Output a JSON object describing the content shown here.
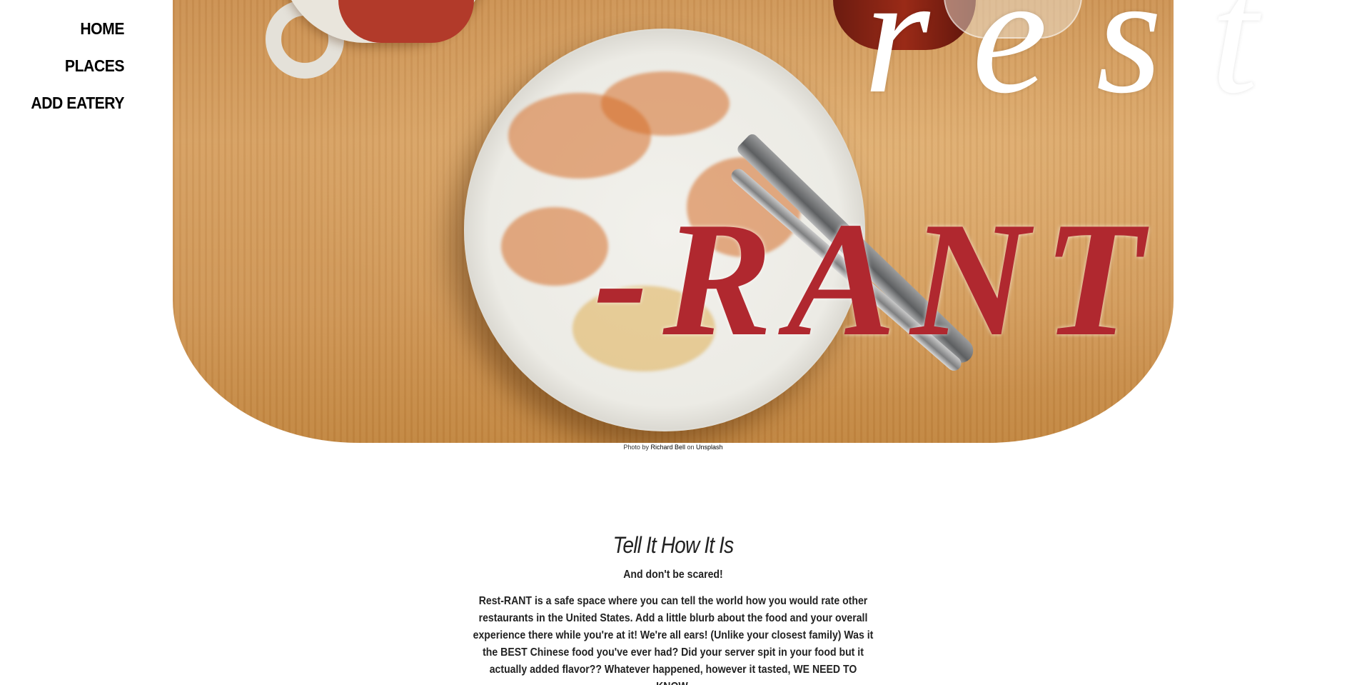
{
  "nav": {
    "items": [
      {
        "label": "HOME"
      },
      {
        "label": "PLACES"
      },
      {
        "label": "ADD EATERY"
      }
    ]
  },
  "hero": {
    "title_top": "rest",
    "title_bottom": "-RANT"
  },
  "credit": {
    "prefix": "Photo by",
    "author": "Richard Bell",
    "middle": "on",
    "source": "Unsplash"
  },
  "main": {
    "heading": "Tell It How It Is",
    "subheading": "And don't be scared!",
    "body": "Rest-RANT is a safe space where you can tell the world how you would rate other restaurants in the United States. Add a little blurb about the food and your overall experience there while you're at it! We're all ears! (Unlike your closest family) Was it the BEST Chinese food you've ever had? Did your server spit in your food but it actually added flavor?? Whatever happened, however it tasted, WE NEED TO KNOW."
  },
  "colors": {
    "accent_red": "#b0282f",
    "text": "#222222"
  }
}
